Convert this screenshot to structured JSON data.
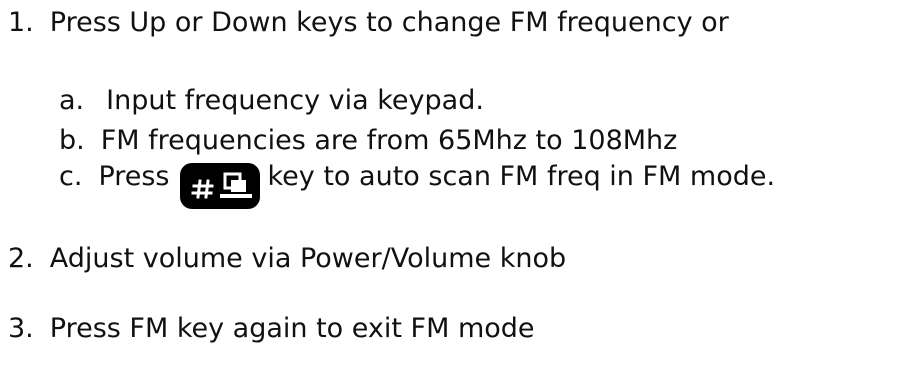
{
  "items": {
    "item1": {
      "number": "1.",
      "text": "Press Up or Down keys to change FM frequency or"
    },
    "sub_a": {
      "letter": "a.",
      "text": "Input frequency via keypad."
    },
    "sub_b": {
      "letter": "b.",
      "text": "FM frequencies are from 65Mhz to 108Mhz"
    },
    "sub_c": {
      "letter": "c.",
      "prefix": "Press",
      "suffix": "key to auto scan FM freq in FM mode.",
      "key_icon": "hash-scan-key-icon"
    },
    "item2": {
      "number": "2.",
      "text": "Adjust volume via Power/Volume knob"
    },
    "item3": {
      "number": "3.",
      "text": "Press FM key again to exit FM mode"
    }
  },
  "colors": {
    "text": "#111111",
    "key_background": "#000000",
    "key_glyph": "#ffffff"
  }
}
